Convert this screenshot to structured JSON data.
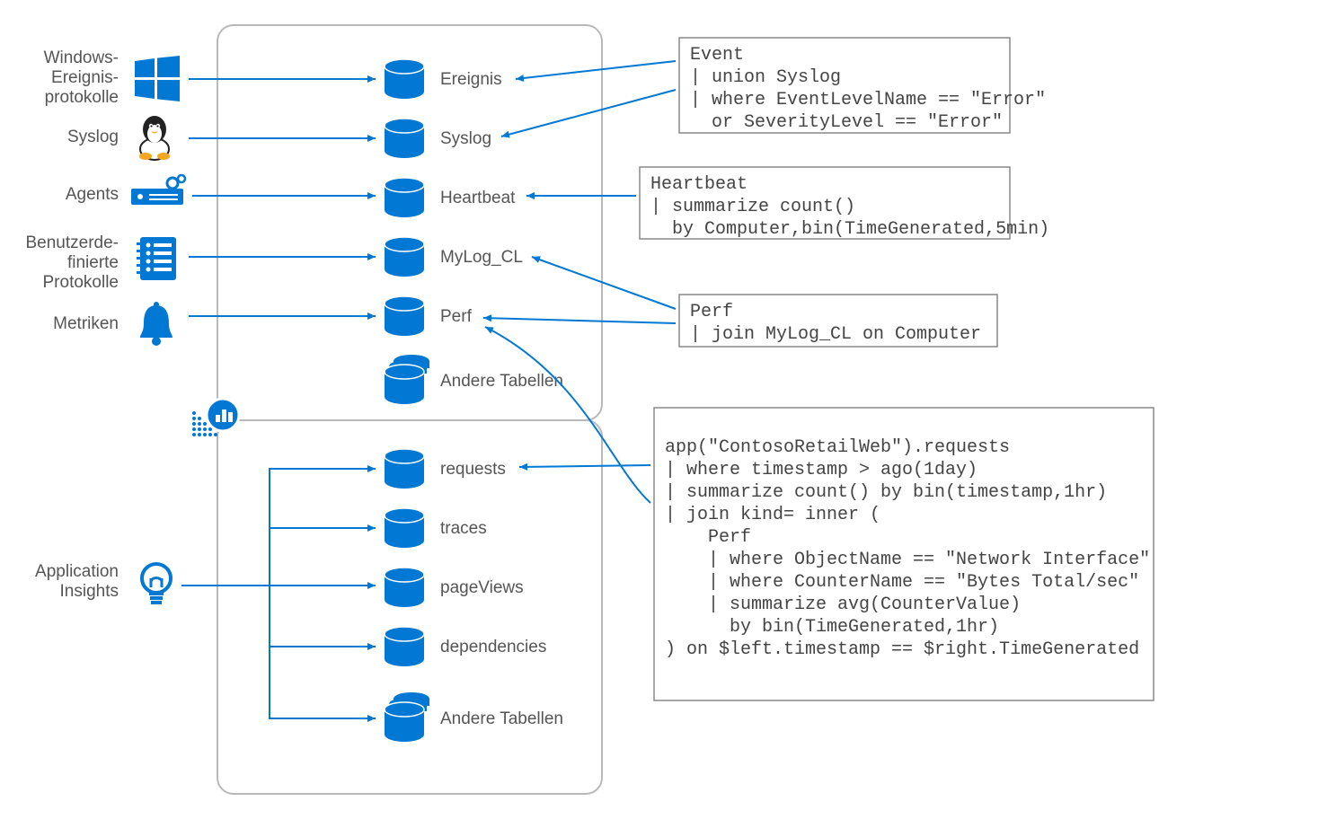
{
  "sources": [
    {
      "id": "windows",
      "label": "Windows-\nEreignis-\nprotokolle"
    },
    {
      "id": "syslog",
      "label": "Syslog"
    },
    {
      "id": "agents",
      "label": "Agents"
    },
    {
      "id": "customlogs",
      "label": "Benutzerde-\nfinierte\nProtokolle"
    },
    {
      "id": "metrics",
      "label": "Metriken"
    },
    {
      "id": "appinsights",
      "label": "Application\nInsights"
    }
  ],
  "topTables": [
    {
      "id": "ereignis",
      "label": "Ereignis"
    },
    {
      "id": "syslogTbl",
      "label": "Syslog"
    },
    {
      "id": "heartbeat",
      "label": "Heartbeat"
    },
    {
      "id": "mylog",
      "label": "MyLog_CL"
    },
    {
      "id": "perf",
      "label": "Perf"
    },
    {
      "id": "andere1",
      "label": "Andere Tabellen"
    }
  ],
  "bottomTables": [
    {
      "id": "requests",
      "label": "requests"
    },
    {
      "id": "traces",
      "label": "traces"
    },
    {
      "id": "pageviews",
      "label": "pageViews"
    },
    {
      "id": "dependencies",
      "label": "dependencies"
    },
    {
      "id": "andere2",
      "label": "Andere Tabellen"
    }
  ],
  "queries": {
    "q1": "Event\n| union Syslog\n| where EventLevelName == \"Error\"\n  or SeverityLevel == \"Error\"",
    "q2": "Heartbeat\n| summarize count()\n  by Computer,bin(TimeGenerated,5min)",
    "q3": "Perf\n| join MyLog_CL on Computer",
    "q4": "\napp(\"ContosoRetailWeb\").requests\n| where timestamp > ago(1day)\n| summarize count() by bin(timestamp,1hr)\n| join kind= inner (\n    Perf\n    | where ObjectName == \"Network Interface\"\n    | where CounterName == \"Bytes Total/sec\"\n    | summarize avg(CounterValue)\n      by bin(TimeGenerated,1hr)\n) on $left.timestamp == $right.TimeGenerated\n"
  }
}
